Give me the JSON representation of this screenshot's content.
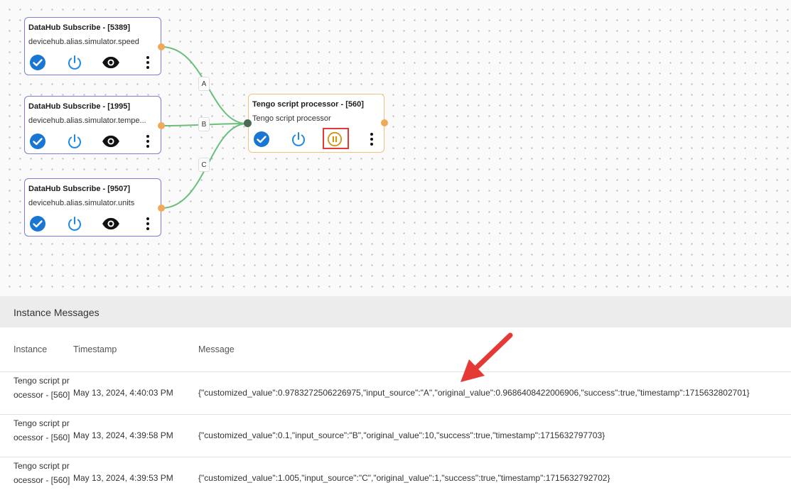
{
  "canvas": {
    "nodes": [
      {
        "title": "DataHub Subscribe - [5389]",
        "subtitle": "devicehub.alias.simulator.speed"
      },
      {
        "title": "DataHub Subscribe - [1995]",
        "subtitle": "devicehub.alias.simulator.tempe..."
      },
      {
        "title": "DataHub Subscribe - [9507]",
        "subtitle": "devicehub.alias.simulator.units"
      }
    ],
    "processor": {
      "title": "Tengo script processor - [560]",
      "subtitle": "Tengo script processor"
    },
    "edge_labels": [
      "A",
      "B",
      "C"
    ]
  },
  "colors": {
    "node_border": "#7b7fd6",
    "processor_border": "#f1c27d",
    "edge": "#6bbf7a",
    "port": "#f0a956",
    "check": "#1976d2",
    "power": "#1e88e5",
    "pause": "#d4940f",
    "highlight": "#e53935"
  },
  "messages_panel": {
    "title": "Instance Messages",
    "columns": {
      "instance": "Instance",
      "timestamp": "Timestamp",
      "message": "Message"
    },
    "rows": [
      {
        "instance": "Tengo script processor - [560]",
        "timestamp": "May 13, 2024, 4:40:03 PM",
        "message": "{\"customized_value\":0.9783272506226975,\"input_source\":\"A\",\"original_value\":0.9686408422006906,\"success\":true,\"timestamp\":1715632802701}"
      },
      {
        "instance": "Tengo script processor - [560]",
        "timestamp": "May 13, 2024, 4:39:58 PM",
        "message": "{\"customized_value\":0.1,\"input_source\":\"B\",\"original_value\":10,\"success\":true,\"timestamp\":1715632797703}"
      },
      {
        "instance": "Tengo script processor - [560]",
        "timestamp": "May 13, 2024, 4:39:53 PM",
        "message": "{\"customized_value\":1.005,\"input_source\":\"C\",\"original_value\":1,\"success\":true,\"timestamp\":1715632792702}"
      }
    ]
  }
}
